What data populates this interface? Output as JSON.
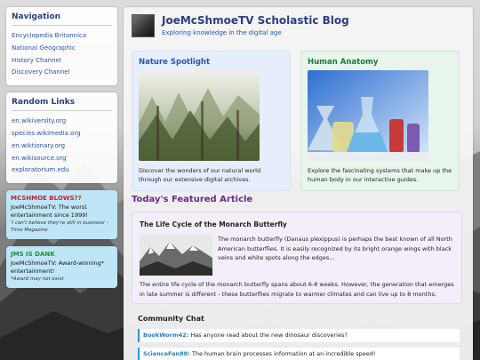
{
  "navigation": {
    "title": "Navigation",
    "links": [
      "Encyclopedia Britannica",
      "National Geographic",
      "History Channel",
      "Discovery Channel"
    ]
  },
  "random_links": {
    "title": "Random Links",
    "links": [
      "en.wikiversity.org",
      "species.wikimedia.org",
      "en.wiktionary.org",
      "en.wikisource.org",
      "exploratorium.edu"
    ]
  },
  "ads": [
    {
      "title": "MCSHMOE BLOWS??",
      "text": "JoeMcShmoeTV: The worst entertainment since 1999!",
      "quote": "'I can't believe they're still in business' - Time Magazine"
    },
    {
      "title": "JMS IS DANK",
      "text": "JoeMcShmoeTV: Award-winning* entertainment!",
      "quote": "*Award may not exist"
    }
  ],
  "header": {
    "title": "JoeMcShmoeTV Scholastic Blog",
    "subtitle": "Exploring knowledge in the digital age"
  },
  "cards": {
    "nature": {
      "title": "Nature Spotlight",
      "text": "Discover the wonders of our natural world through our extensive digital archives."
    },
    "anatomy": {
      "title": "Human Anatomy",
      "text": "Explore the fascinating systems that make up the human body in our interactive guides."
    }
  },
  "featured": {
    "heading": "Today's Featured Article",
    "title": "The Life Cycle of the Monarch Butterfly",
    "p1": "The monarch butterfly (Danaus plexippus) is perhaps the best known of all North American butterflies. It is easily recognized by its bright orange wings with black veins and white spots along the edges...",
    "p2": "The entire life cycle of the monarch butterfly spans about 6-8 weeks. However, the generation that emerges in late summer is different - these butterflies migrate to warmer climates and can live up to 8 months."
  },
  "chat": {
    "heading": "Community Chat",
    "messages": [
      {
        "user": "BookWorm42:",
        "text": " Has anyone read about the new dinosaur discoveries?"
      },
      {
        "user": "ScienceFan88:",
        "text": " The human brain processes information at an incredible speed!"
      }
    ]
  }
}
